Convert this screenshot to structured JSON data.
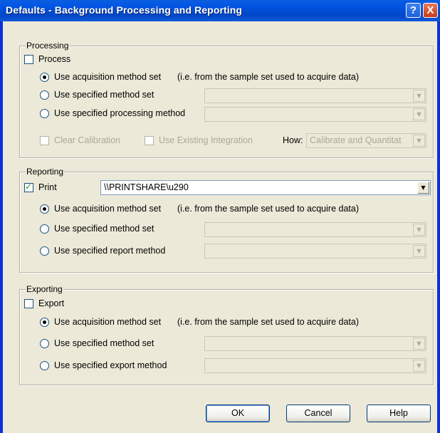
{
  "window": {
    "title": "Defaults - Background Processing and Reporting",
    "help_glyph": "?",
    "close_glyph": "X"
  },
  "processing": {
    "group_label": "Processing",
    "checkbox_label": "Process",
    "radio1_label": "Use acquisition method set",
    "radio1_hint": "(i.e. from the sample set used to acquire data)",
    "radio2_label": "Use specified method set",
    "radio3_label": "Use specified processing method",
    "clear_calibration_label": "Clear Calibration",
    "use_existing_integration_label": "Use Existing Integration",
    "how_label": "How:",
    "how_value": "Calibrate and Quantitat"
  },
  "reporting": {
    "group_label": "Reporting",
    "checkbox_label": "Print",
    "printer_value": "\\\\PRINTSHARE\\u290",
    "radio1_label": "Use acquisition method set",
    "radio1_hint": "(i.e. from the sample set used to acquire data)",
    "radio2_label": "Use specified method set",
    "radio3_label": "Use specified report method"
  },
  "exporting": {
    "group_label": "Exporting",
    "checkbox_label": "Export",
    "radio1_label": "Use acquisition method set",
    "radio1_hint": "(i.e. from the sample set used to acquire data)",
    "radio2_label": "Use specified method set",
    "radio3_label": "Use specified export method"
  },
  "buttons": {
    "ok": "OK",
    "cancel": "Cancel",
    "help": "Help"
  },
  "arrow_glyph": "▼"
}
